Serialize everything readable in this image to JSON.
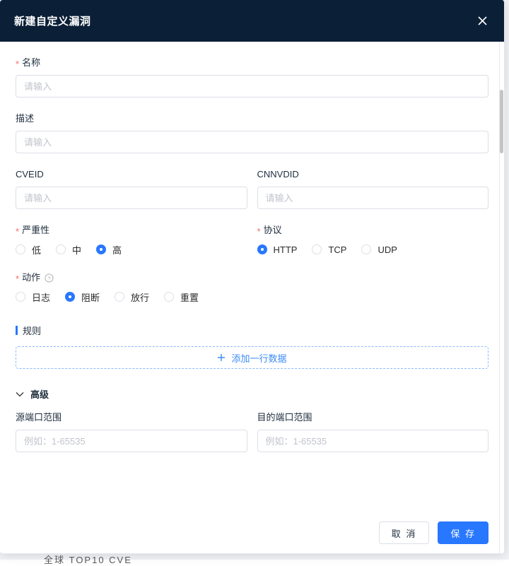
{
  "modal": {
    "title": "新建自定义漏洞",
    "close_icon": "close-icon"
  },
  "background": {
    "cut_off_text": "全球 TOP10 CVE"
  },
  "form": {
    "name": {
      "label": "名称",
      "required_marker": "*",
      "placeholder": "请输入",
      "value": ""
    },
    "description": {
      "label": "描述",
      "placeholder": "请输入",
      "value": ""
    },
    "cveid": {
      "label": "CVEID",
      "placeholder": "请输入",
      "value": ""
    },
    "cnnvdid": {
      "label": "CNNVDID",
      "placeholder": "请输入",
      "value": ""
    },
    "severity": {
      "label": "严重性",
      "required_marker": "*",
      "options": [
        {
          "label": "低",
          "checked": false
        },
        {
          "label": "中",
          "checked": false
        },
        {
          "label": "高",
          "checked": true
        }
      ]
    },
    "protocol": {
      "label": "协议",
      "required_marker": "*",
      "options": [
        {
          "label": "HTTP",
          "checked": true
        },
        {
          "label": "TCP",
          "checked": false
        },
        {
          "label": "UDP",
          "checked": false
        }
      ]
    },
    "action": {
      "label": "动作",
      "required_marker": "*",
      "help_icon": "question-circle-icon",
      "options": [
        {
          "label": "日志",
          "checked": false
        },
        {
          "label": "阻断",
          "checked": true
        },
        {
          "label": "放行",
          "checked": false
        },
        {
          "label": "重置",
          "checked": false
        }
      ]
    },
    "rules": {
      "section_title": "规则",
      "add_row_label": "添加一行数据",
      "add_row_icon": "plus-icon"
    },
    "advanced": {
      "toggle_label": "高级",
      "toggle_icon": "chevron-down-icon",
      "source_port_range": {
        "label": "源端口范围",
        "placeholder": "例如：1-65535",
        "value": ""
      },
      "dest_port_range": {
        "label": "目的端口范围",
        "placeholder": "例如：1-65535",
        "value": ""
      }
    }
  },
  "footer": {
    "cancel_label": "取 消",
    "save_label": "保 存"
  },
  "colors": {
    "header_bg": "#0b1f36",
    "primary": "#2877ff",
    "required_star": "#f56c6c",
    "border": "#dcdfe6",
    "placeholder": "#c0c4cc"
  }
}
